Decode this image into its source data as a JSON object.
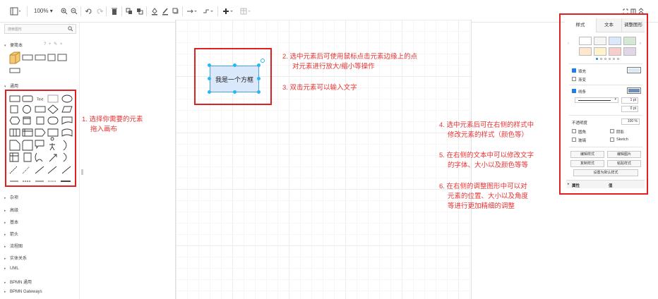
{
  "toolbar": {
    "zoom": "100%",
    "icons": [
      "sidebar-toggle-icon",
      "zoom-in-icon",
      "zoom-out-icon",
      "undo-icon",
      "redo-icon",
      "delete-icon",
      "to-front-icon",
      "to-back-icon",
      "fill-color-icon",
      "line-color-icon",
      "shadow-icon",
      "connection-icon",
      "waypoints-icon",
      "insert-icon",
      "table-icon",
      "fullscreen-icon",
      "format-panel-icon",
      "collapse-icon"
    ]
  },
  "sidebar": {
    "search_placeholder": "搜索图形",
    "sections": [
      {
        "label": "便笺本",
        "expanded": true
      },
      {
        "label": "通用",
        "expanded": true
      },
      {
        "label": "杂项",
        "expanded": false
      },
      {
        "label": "高级",
        "expanded": false
      },
      {
        "label": "基本",
        "expanded": false
      },
      {
        "label": "箭头",
        "expanded": false
      },
      {
        "label": "流程图",
        "expanded": false
      },
      {
        "label": "实体关系",
        "expanded": false
      },
      {
        "label": "UML",
        "expanded": false
      },
      {
        "label": "BPMN 通用",
        "expanded": false
      },
      {
        "label": "BPMN Gateways",
        "expanded": false
      }
    ],
    "general_text_label": "Text"
  },
  "canvas": {
    "shape_text": "我是一个方框"
  },
  "annotations": {
    "note1": [
      "1. 选择你需要的元素",
      "拖入画布"
    ],
    "note2": [
      "2. 选中元素后可使用鼠标点击元素边缘上的点",
      "对元素进行放大/缩小等操作"
    ],
    "note3": [
      "3. 双击元素可以输入文字"
    ],
    "note4": [
      "4. 选中元素后可在右侧的样式中",
      "修改元素的样式（颜色等）"
    ],
    "note5": [
      "5. 在右侧的文本中可以修改文字",
      "的字体、大小以及颜色等等"
    ],
    "note6": [
      "6. 在右侧的调整图形中可以对",
      "元素的位置、大小以及角度",
      "等进行更加精细的调整"
    ]
  },
  "format_panel": {
    "tabs": [
      "样式",
      "文本",
      "调整图形"
    ],
    "swatches": [
      "#ffffff",
      "#f5f5f5",
      "#dae8fc",
      "#d5e8d4",
      "#ffe6cc",
      "#fff2cc",
      "#f8cecc",
      "#e1d5e7"
    ],
    "fill_label": "填充",
    "fill_color": "#dae8fc",
    "gradient_label": "渐变",
    "line_label": "线条",
    "line_color": "#6c8ebf",
    "line_width": "1 pt",
    "perimeter": "0 pt",
    "opacity_label": "不透明度",
    "opacity_value": "100 %",
    "rounded_label": "圆角",
    "shadow_label": "阴影",
    "glass_label": "玻璃",
    "sketch_label": "Sketch",
    "buttons": [
      "编辑样式",
      "编辑图片",
      "复制样式",
      "粘贴样式",
      "设置为默认样式"
    ],
    "property_header": "属性",
    "value_header": "值"
  },
  "colors": {
    "annotation_red": "#e02020",
    "selection_blue": "#29b6f2"
  }
}
